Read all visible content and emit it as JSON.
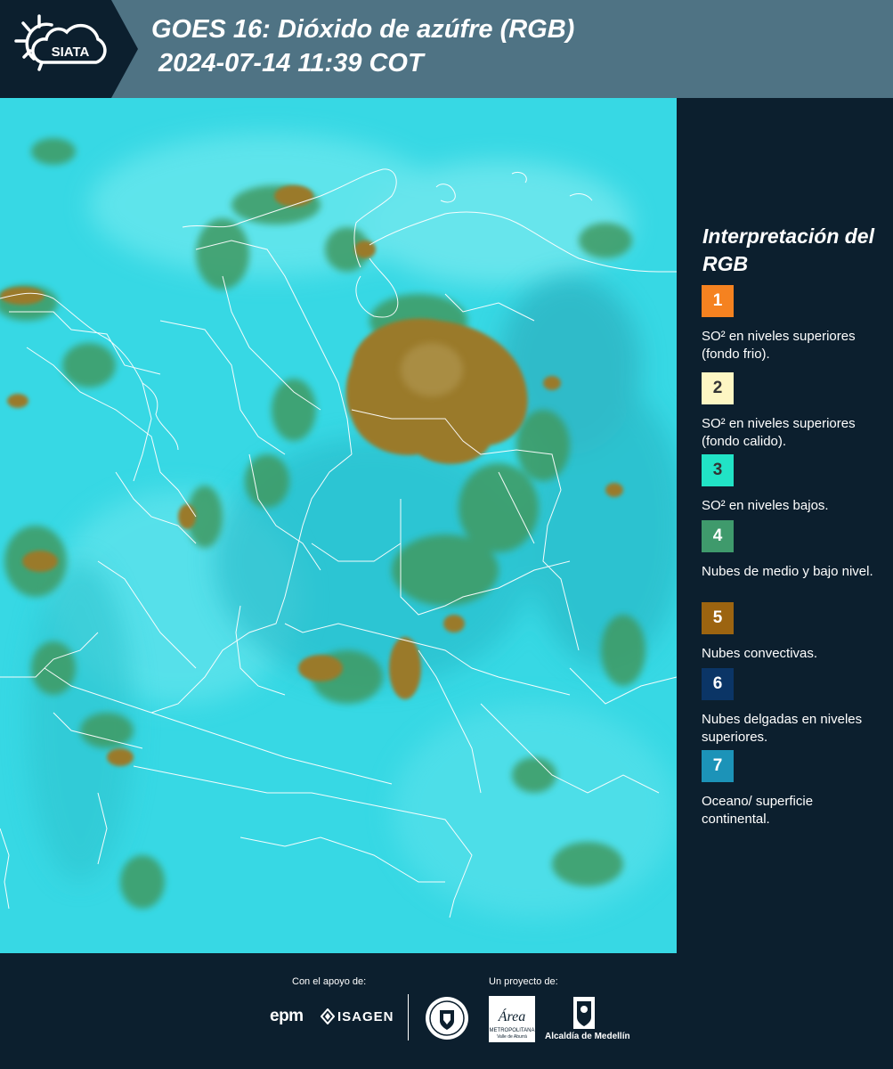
{
  "header": {
    "logo_text": "SIATA",
    "title_line1": "GOES 16: Dióxido de azúfre (RGB)",
    "title_line2": "2024-07-14 11:39 COT"
  },
  "colors": {
    "header_bg": "#4f7384",
    "logo_bg": "#0c1f2e",
    "panel_bg": "#0c1f2e",
    "map_cyan": "#33d6e3",
    "map_green": "#3f9a62",
    "map_brown": "#9a7a2a",
    "borders": "#ffffff"
  },
  "legend": {
    "title": "Interpretación del RGB",
    "items": [
      {
        "number": "1",
        "color": "#f58220",
        "text": "SO² en niveles superiores (fondo frio)."
      },
      {
        "number": "2",
        "color": "#fdf6c3",
        "text": "SO² en niveles superiores (fondo calido)."
      },
      {
        "number": "3",
        "color": "#21e3c6",
        "text": "SO² en niveles bajos."
      },
      {
        "number": "4",
        "color": "#3f9a6c",
        "text": "Nubes de medio y bajo nivel."
      },
      {
        "number": "5",
        "color": "#9c6410",
        "text": "Nubes convectivas."
      },
      {
        "number": "6",
        "color": "#0b3566",
        "text": "Nubes delgadas en niveles superiores."
      },
      {
        "number": "7",
        "color": "#1c93b8",
        "text": "Oceano/ superficie continental."
      }
    ]
  },
  "footer": {
    "support_label": "Con el apoyo de:",
    "project_label": "Un proyecto de:",
    "epm_text": "epm",
    "isagen_text": "ISAGEN",
    "area_text": "Área",
    "area_subtext": "METROPOLITANA",
    "area_subtext2": "Valle de Aburrá",
    "alcaldia_text": "Alcaldía de Medellín"
  }
}
